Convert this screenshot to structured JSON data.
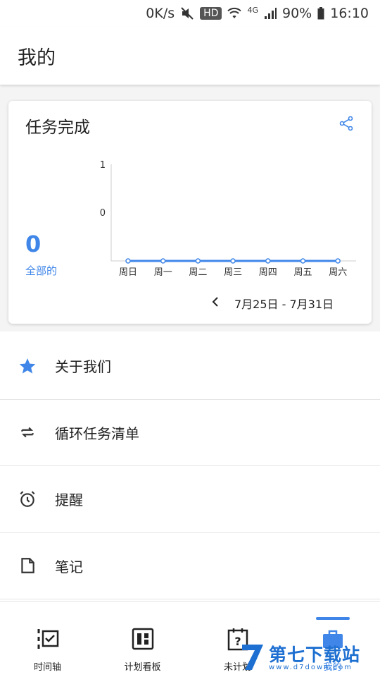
{
  "status_bar": {
    "speed": "0K/s",
    "hd": "HD",
    "network": "4G",
    "battery": "90%",
    "time": "16:10"
  },
  "header": {
    "title": "我的"
  },
  "task_card": {
    "title": "任务完成",
    "total_value": "0",
    "total_label": "全部的",
    "date_range": "7月25日 - 7月31日",
    "accent_color": "#3f86e8"
  },
  "chart_data": {
    "type": "line",
    "categories": [
      "周日",
      "周一",
      "周二",
      "周三",
      "周四",
      "周五",
      "周六"
    ],
    "series": [
      {
        "values": [
          0,
          0,
          0,
          0,
          0,
          0,
          0
        ]
      }
    ],
    "y_ticks": [
      "1",
      "0"
    ],
    "title": "",
    "xlabel": "",
    "ylabel": ""
  },
  "menu": {
    "items": [
      {
        "label": "关于我们",
        "icon": "star-icon"
      },
      {
        "label": "循环任务清单",
        "icon": "repeat-icon"
      },
      {
        "label": "提醒",
        "icon": "alarm-icon"
      },
      {
        "label": "笔记",
        "icon": "note-icon"
      }
    ]
  },
  "bottom_nav": {
    "items": [
      {
        "label": "时间轴",
        "icon": "timeline-icon"
      },
      {
        "label": "计划看板",
        "icon": "board-icon"
      },
      {
        "label": "未计划",
        "icon": "unplanned-icon"
      },
      {
        "label": "我的",
        "icon": "briefcase-icon"
      }
    ],
    "active_index": 3
  },
  "watermark": {
    "text": "第七下载站",
    "url": "www.d7down.com"
  }
}
